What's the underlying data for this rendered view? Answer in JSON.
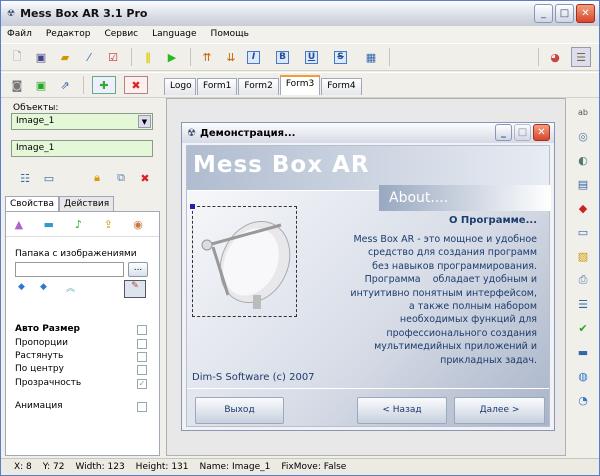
{
  "window": {
    "title": "Mess Box AR 3.1 Pro"
  },
  "menu": [
    "Файл",
    "Редактор",
    "Сервис",
    "Language",
    "Помощь"
  ],
  "form_tabs": [
    "Logo",
    "Form1",
    "Form2",
    "Form3",
    "Form4"
  ],
  "active_form_tab": "Form3",
  "left": {
    "objects_label": "Объекты:",
    "objects_select": "Image_1",
    "name_field": "Image_1",
    "prop_tabs": [
      "Свойства",
      "Действия"
    ],
    "folder_label": "Папака с изображениями",
    "folder_value": "",
    "browse_label": "...",
    "options": [
      {
        "label": "Авто Размер",
        "checked": false,
        "bold": true
      },
      {
        "label": "Пропорции",
        "checked": false
      },
      {
        "label": "Растянуть",
        "checked": false
      },
      {
        "label": "По центру",
        "checked": false
      },
      {
        "label": "Прозрачность",
        "checked": true
      },
      {
        "label": "Анимация",
        "checked": false
      }
    ]
  },
  "dialog": {
    "title": "Демонстрация...",
    "banner": "Mess Box AR",
    "about": "About....",
    "heading": "О Программе...",
    "lines": [
      "Mess Box AR - это мощное и удобное",
      "средство для создания программ",
      "без навыков программирования.",
      "Программа    обладает удобным и",
      "интуитивно понятным интерфейсом,",
      "а также полным набором",
      "необходимых функций для",
      "профессионального создания",
      "мультимедийных приложений и",
      "прикладных задач."
    ],
    "copyright": "Dim-S Software (c) 2007",
    "buttons": {
      "exit": "Выход",
      "back": "< Назад",
      "next": "Далее >"
    }
  },
  "status": {
    "x": "X: 8",
    "y": "Y: 72",
    "width": "Width: 123",
    "height": "Height: 131",
    "name": "Name: Image_1",
    "fixmove": "FixMove: False"
  }
}
